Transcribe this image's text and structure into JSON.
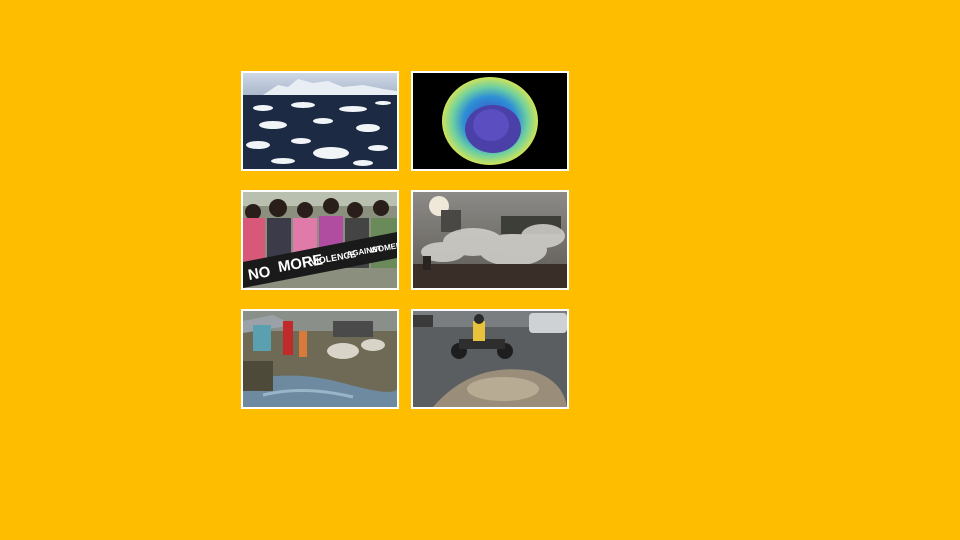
{
  "slide": {
    "background": "#FFBD00",
    "images": [
      {
        "id": "sea-ice",
        "subject": "melting sea ice floes"
      },
      {
        "id": "ozone-hole",
        "subject": "ozone hole over the globe"
      },
      {
        "id": "protest",
        "subject": "women holding protest banner"
      },
      {
        "id": "smoke",
        "subject": "burning waste and smoke"
      },
      {
        "id": "slum",
        "subject": "polluted drainage in slum"
      },
      {
        "id": "road",
        "subject": "motorcycle on damaged flooded road"
      }
    ],
    "banner": {
      "word1": "NO",
      "word2": "MORE",
      "word3": "VIOLENCE",
      "word4": "AGAINST",
      "word5": "WOMEN"
    }
  }
}
